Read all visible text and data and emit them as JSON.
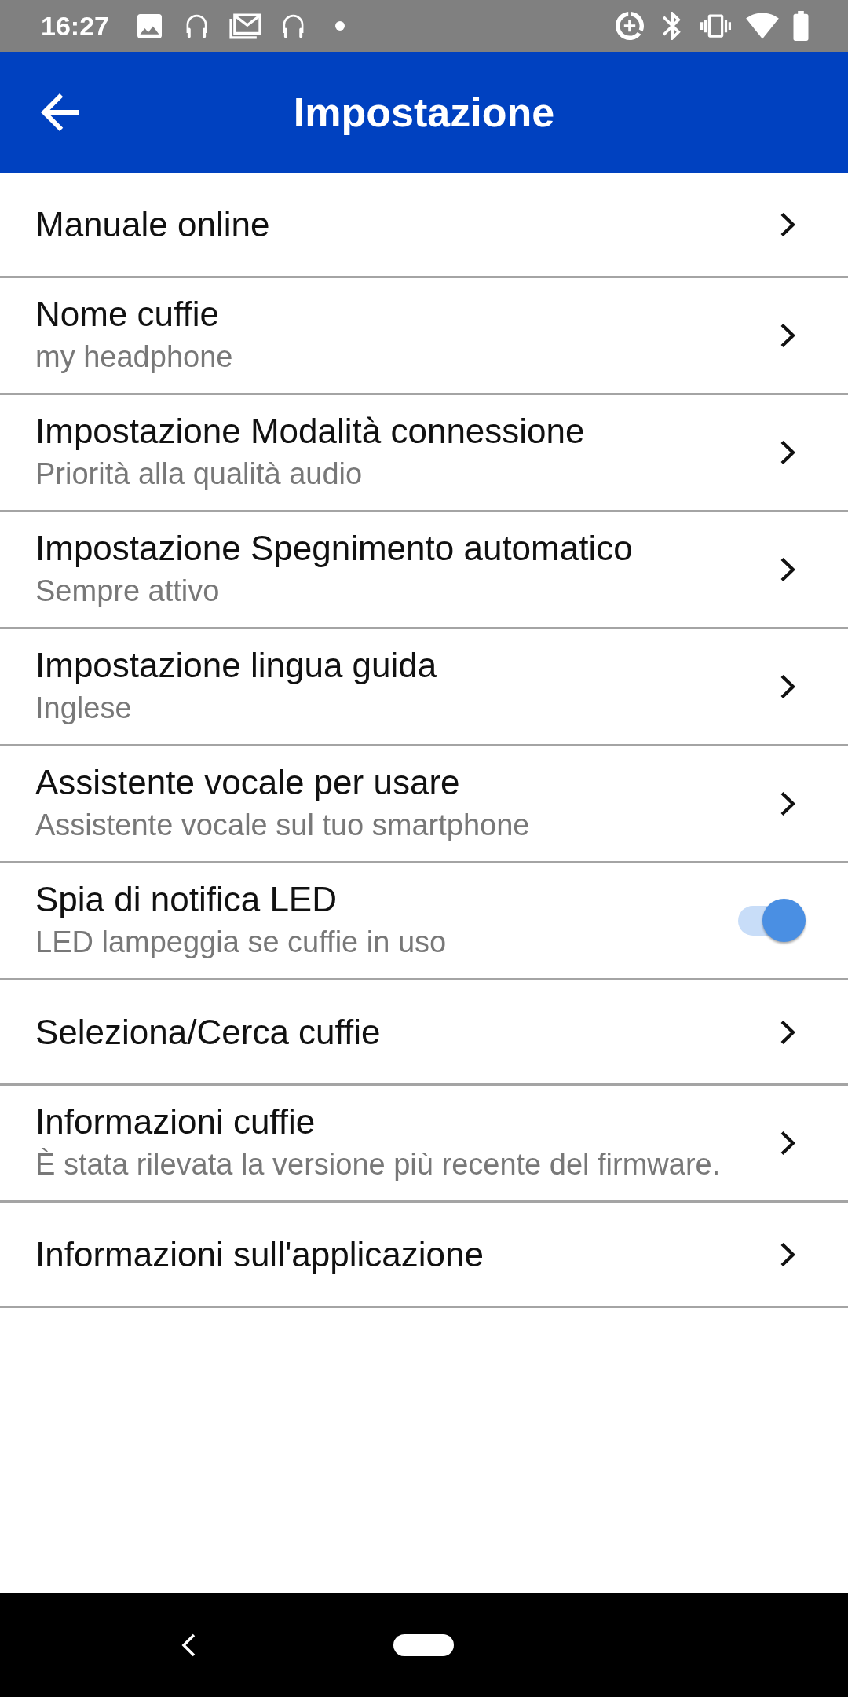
{
  "status_bar": {
    "time": "16:27"
  },
  "app_bar": {
    "title": "Impostazione"
  },
  "settings": [
    {
      "kind": "link",
      "title": "Manuale online"
    },
    {
      "kind": "link",
      "title": "Nome cuffie",
      "subtitle": "my headphone"
    },
    {
      "kind": "link",
      "title": "Impostazione Modalità connessione",
      "subtitle": "Priorità alla qualità audio"
    },
    {
      "kind": "link",
      "title": "Impostazione Spegnimento automatico",
      "subtitle": "Sempre attivo"
    },
    {
      "kind": "link",
      "title": "Impostazione lingua guida",
      "subtitle": "Inglese"
    },
    {
      "kind": "link",
      "title": "Assistente vocale per usare",
      "subtitle": "Assistente vocale sul tuo smartphone"
    },
    {
      "kind": "toggle",
      "title": "Spia di notifica LED",
      "subtitle": "LED lampeggia se cuffie in uso",
      "on": true
    },
    {
      "kind": "link",
      "title": "Seleziona/Cerca cuffie"
    },
    {
      "kind": "link",
      "title": "Informazioni cuffie",
      "subtitle": "È stata rilevata la versione più recente del firmware."
    },
    {
      "kind": "link",
      "title": "Informazioni sull'applicazione"
    }
  ]
}
